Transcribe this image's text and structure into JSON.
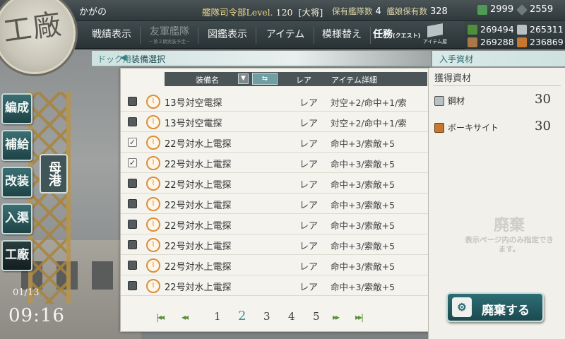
{
  "header": {
    "fleet_name": "かがの",
    "hq_level_label": "艦隊司令部Level.",
    "hq_level": "120",
    "rank": "[大将]",
    "ships_label": "保有艦隊数",
    "ships_value": "4",
    "kanmusu_label": "艦娘保有数",
    "kanmusu_value": "328",
    "buckets": "2999",
    "dev_material": "2559"
  },
  "emblem": {
    "text": "工廠"
  },
  "menu": {
    "items": [
      {
        "label": "戦績表示"
      },
      {
        "label": "友軍艦隊",
        "sub": "－第２期実装予定－"
      },
      {
        "label": "図鑑表示"
      },
      {
        "label": "アイテム"
      },
      {
        "label": "模様替え"
      },
      {
        "label": "任務",
        "sub": "(クエスト)"
      }
    ],
    "item_shop": "アイテム屋"
  },
  "resources": {
    "fuel": "269494",
    "steel": "265311",
    "ammo": "269288",
    "bauxite": "236869",
    "colors": {
      "fuel": "#4f8f3a",
      "ammo": "#a9784a",
      "steel": "#b8c0c3",
      "bauxite": "#c8772f"
    }
  },
  "leftnav": {
    "items": [
      {
        "label": "編成"
      },
      {
        "label": "補給"
      },
      {
        "label": "改装"
      },
      {
        "label": "入渠"
      },
      {
        "label": "工廠"
      }
    ],
    "bokou": "母港"
  },
  "clock": {
    "date": "01/13",
    "time": "09:16"
  },
  "dock_header": {
    "label": "ドック用",
    "arrow": "◀",
    "title": "装備選択"
  },
  "equipment": {
    "columns": {
      "name": "装備名",
      "rarity": "レア",
      "detail": "アイテム詳細"
    },
    "rows": [
      {
        "name": "13号対空電探",
        "rarity": "レア",
        "detail": "対空+2/命中+1/索",
        "checked": false
      },
      {
        "name": "13号対空電探",
        "rarity": "レア",
        "detail": "対空+2/命中+1/索",
        "checked": false
      },
      {
        "name": "22号対水上電探",
        "rarity": "レア",
        "detail": "命中+3/索敵+5",
        "checked": true
      },
      {
        "name": "22号対水上電探",
        "rarity": "レア",
        "detail": "命中+3/索敵+5",
        "checked": true
      },
      {
        "name": "22号対水上電探",
        "rarity": "レア",
        "detail": "命中+3/索敵+5",
        "checked": false
      },
      {
        "name": "22号対水上電探",
        "rarity": "レア",
        "detail": "命中+3/索敵+5",
        "checked": false
      },
      {
        "name": "22号対水上電探",
        "rarity": "レア",
        "detail": "命中+3/索敵+5",
        "checked": false
      },
      {
        "name": "22号対水上電探",
        "rarity": "レア",
        "detail": "命中+3/索敵+5",
        "checked": false
      },
      {
        "name": "22号対水上電探",
        "rarity": "レア",
        "detail": "命中+3/索敵+5",
        "checked": false
      },
      {
        "name": "22号対水上電探",
        "rarity": "レア",
        "detail": "命中+3/索敵+5",
        "checked": false
      }
    ],
    "pages": [
      "1",
      "2",
      "3",
      "4",
      "5"
    ],
    "current_page": "2"
  },
  "acquired": {
    "header": "入手資材",
    "title": "獲得資材",
    "items": [
      {
        "name": "鋼材",
        "value": "30",
        "icon": "steel-icon"
      },
      {
        "name": "ボーキサイト",
        "value": "30",
        "icon": "bauxite-icon"
      }
    ],
    "watermark_title": "廃棄",
    "watermark_text": "表示ページ内のみ指定できます。"
  },
  "scrap_button": {
    "label": "廃棄する"
  }
}
